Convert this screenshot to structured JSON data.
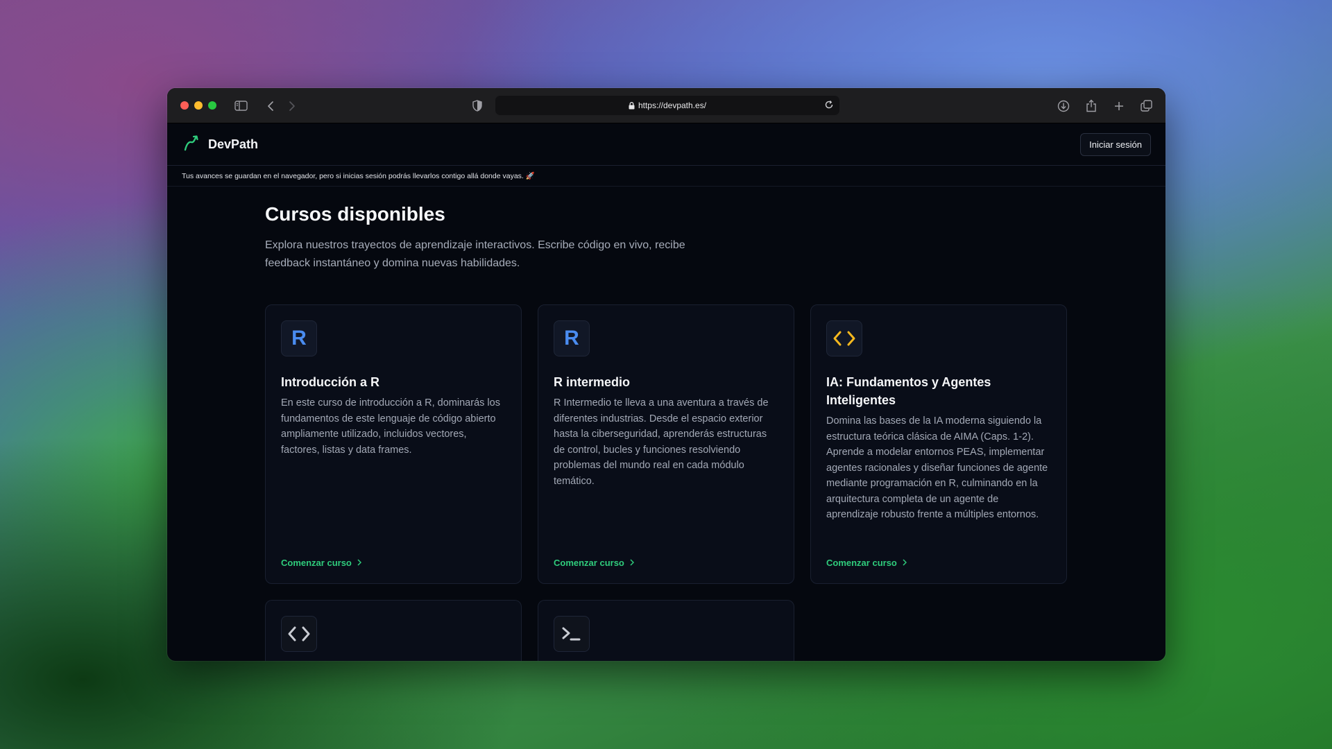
{
  "browser": {
    "url": "https://devpath.es/",
    "colors": {
      "close": "#fe5f57",
      "minimize": "#febc2e",
      "maximize": "#28c840"
    }
  },
  "app": {
    "brand": "DevPath",
    "login_label": "Iniciar sesión",
    "notice": "Tus avances se guardan en el navegador, pero si inicias sesión podrás llevarlos contigo allá donde vayas. 🚀",
    "accent": "#2fcc7c"
  },
  "main": {
    "title": "Cursos disponibles",
    "intro": "Explora nuestros trayectos de aprendizaje interactivos. Escribe código en vivo, recibe feedback instantáneo y domina nuevas habilidades."
  },
  "courses": [
    {
      "icon": "r-letter-icon",
      "icon_text": "R",
      "title": "Introducción a R",
      "description": "En este curso de introducción a R, dominarás los fundamentos de este lenguaje de código abierto ampliamente utilizado, incluidos vectores, factores, listas y data frames.",
      "cta": "Comenzar curso"
    },
    {
      "icon": "r-letter-icon",
      "icon_text": "R",
      "title": "R intermedio",
      "description": "R Intermedio te lleva a una aventura a través de diferentes industrias. Desde el espacio exterior hasta la ciberseguridad, aprenderás estructuras de control, bucles y funciones resolviendo problemas del mundo real en cada módulo temático.",
      "cta": "Comenzar curso"
    },
    {
      "icon": "code-brackets-icon",
      "title": "IA: Fundamentos y Agentes Inteligentes",
      "description": "Domina las bases de la IA moderna siguiendo la estructura teórica clásica de AIMA (Caps. 1-2). Aprende a modelar entornos PEAS, implementar agentes racionales y diseñar funciones de agente mediante programación en R, culminando en la arquitectura completa de un agente de aprendizaje robusto frente a múltiples entornos.",
      "cta": "Comenzar curso"
    }
  ],
  "partial_courses": [
    {
      "icon": "code-brackets-icon"
    },
    {
      "icon": "terminal-prompt-icon"
    }
  ]
}
